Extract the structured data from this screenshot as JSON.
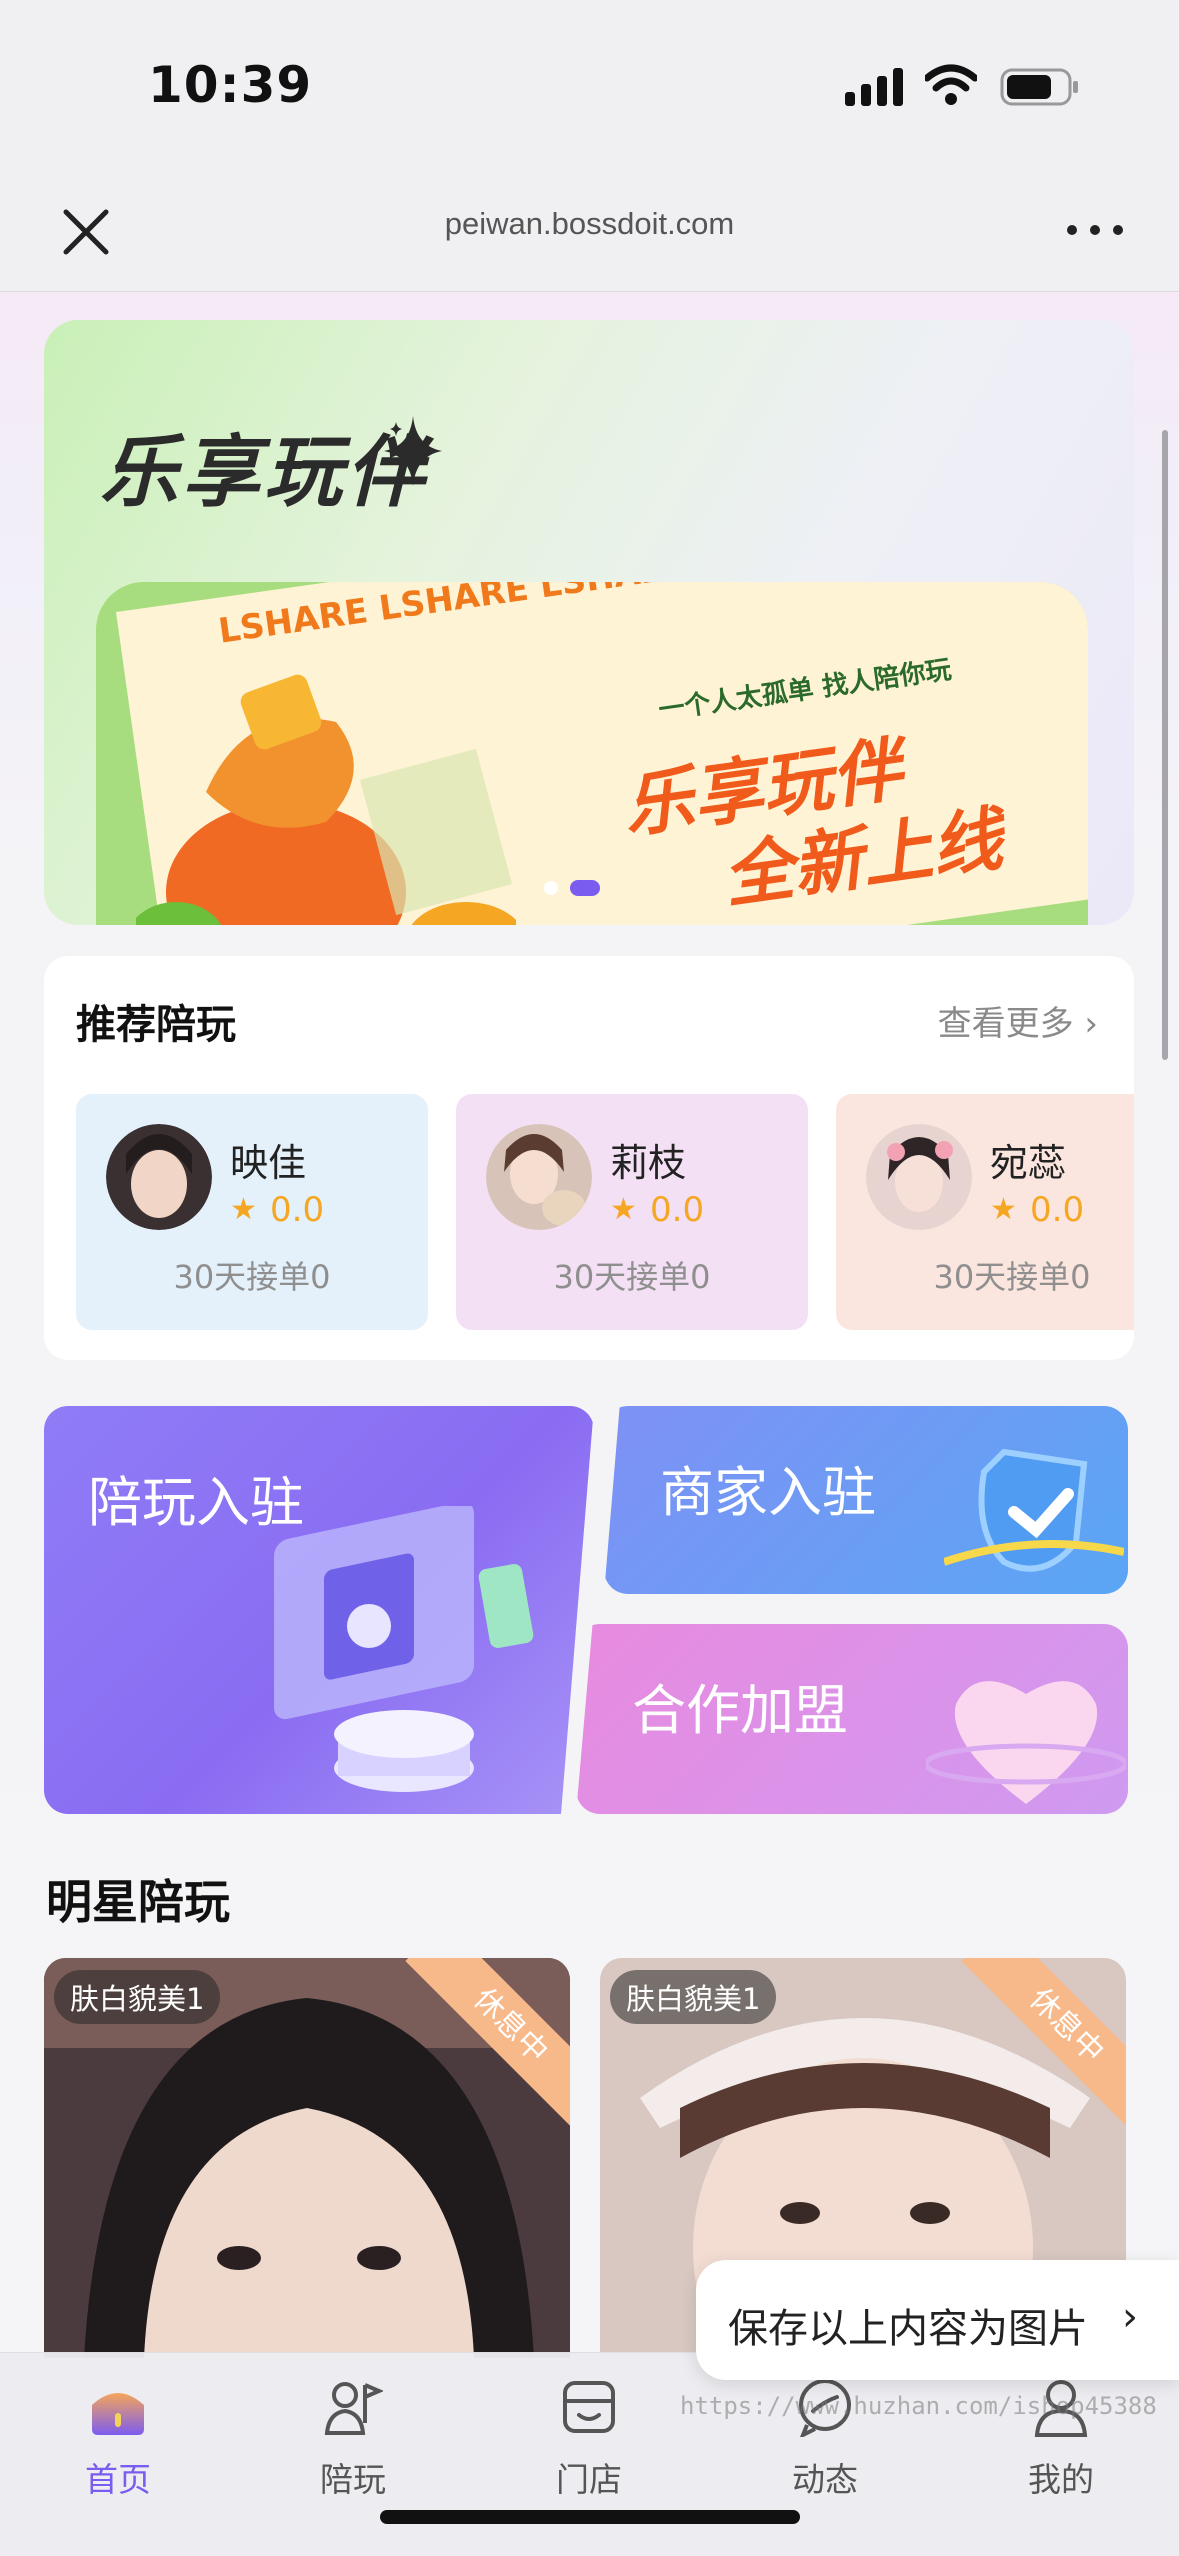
{
  "status_bar": {
    "time": "10:39"
  },
  "browser": {
    "url": "peiwan.bossdoit.com"
  },
  "hero": {
    "title": "乐享玩伴",
    "strip_text": "LSHARE LSHARE LSHARE LSHARE",
    "slogan": "一个人太孤单 找人陪你玩",
    "main_line1": "乐享玩伴",
    "main_line2": "全新上线",
    "active_slide_index": 1
  },
  "recommended": {
    "title": "推荐陪玩",
    "more_label": "查看更多",
    "cards": [
      {
        "name": "映佳",
        "score": "0.0",
        "orders": "30天接单0",
        "bg": "#e4f1fb"
      },
      {
        "name": "莉枝",
        "score": "0.0",
        "orders": "30天接单0",
        "bg": "#f3e0f4"
      },
      {
        "name": "宛蕊",
        "score": "0.0",
        "orders": "30天接单0",
        "bg": "#fbe6df"
      }
    ]
  },
  "promo": {
    "companion_join": "陪玩入驻",
    "merchant_join": "商家入驻",
    "franchise": "合作加盟"
  },
  "star_section": {
    "title": "明星陪玩",
    "photos": [
      {
        "tag": "肤白貌美1",
        "status": "休息中"
      },
      {
        "tag": "肤白貌美1",
        "status": "休息中"
      }
    ]
  },
  "save_bubble": {
    "label": "保存以上内容为图片",
    "arrow": "›"
  },
  "tabbar": {
    "items": [
      {
        "label": "首页"
      },
      {
        "label": "陪玩"
      },
      {
        "label": "门店"
      },
      {
        "label": "动态"
      },
      {
        "label": "我的"
      }
    ],
    "active_index": 0
  },
  "watermark": "https://www.huzhan.com/ishop45388",
  "colors": {
    "accent": "#7b5cf0",
    "star": "#f5a623"
  }
}
